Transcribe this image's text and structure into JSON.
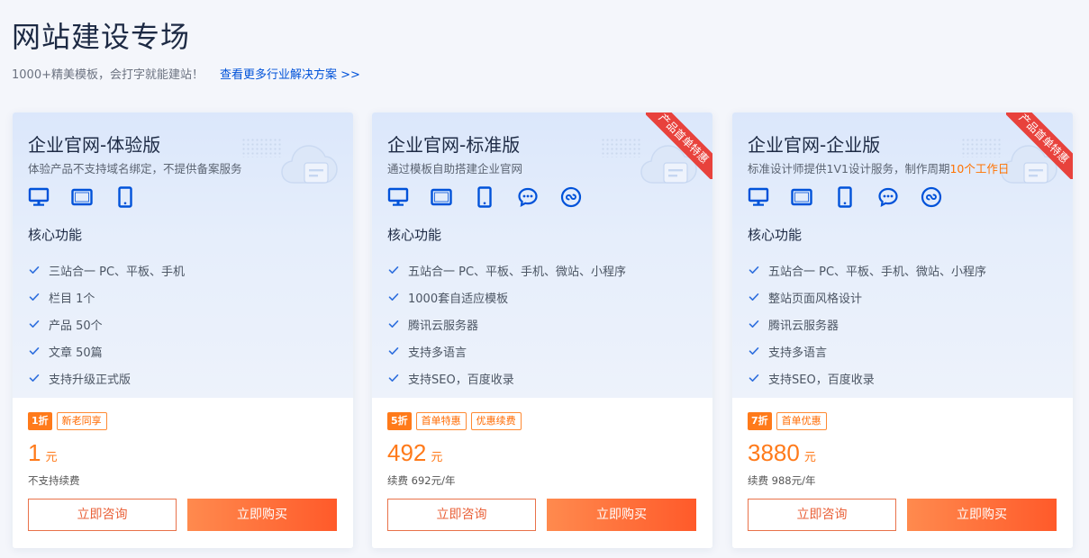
{
  "page": {
    "title": "网站建设专场",
    "subtitle": "1000+精美模板，会打字就能建站！",
    "more_link": "查看更多行业解决方案 >>"
  },
  "colors": {
    "accent": "#0052d9",
    "orange": "#ff7a1a",
    "ribbon": "#e8423c"
  },
  "cards": [
    {
      "title": "企业官网-体验版",
      "desc": "体验产品不支持域名绑定，不提供备案服务",
      "desc_highlight": "",
      "ribbon": "",
      "icons": [
        "desktop-icon",
        "tablet-landscape-icon",
        "mobile-icon"
      ],
      "features_heading": "核心功能",
      "features": [
        "三站合一 PC、平板、手机",
        "栏目 1个",
        "产品 50个",
        "文章 50篇",
        "支持升级正式版"
      ],
      "discount": "1折",
      "tags": [
        "新老同享"
      ],
      "price": "1",
      "price_unit": "元",
      "renew": "不支持续费",
      "consult_label": "立即咨询",
      "buy_label": "立即购买"
    },
    {
      "title": "企业官网-标准版",
      "desc": "通过模板自助搭建企业官网",
      "desc_highlight": "",
      "ribbon": "产品首单特惠",
      "icons": [
        "desktop-icon",
        "tablet-landscape-icon",
        "mobile-icon",
        "wechat-icon",
        "mini-program-icon"
      ],
      "features_heading": "核心功能",
      "features": [
        "五站合一 PC、平板、手机、微站、小程序",
        "1000套自适应模板",
        "腾讯云服务器",
        "支持多语言",
        "支持SEO，百度收录"
      ],
      "discount": "5折",
      "tags": [
        "首单特惠",
        "优惠续费"
      ],
      "price": "492",
      "price_unit": "元",
      "renew": "续费 692元/年",
      "consult_label": "立即咨询",
      "buy_label": "立即购买"
    },
    {
      "title": "企业官网-企业版",
      "desc": "标准设计师提供1V1设计服务，制作周期",
      "desc_highlight": "10个工作日",
      "ribbon": "产品首单特惠",
      "icons": [
        "desktop-icon",
        "tablet-landscape-icon",
        "mobile-icon",
        "wechat-icon",
        "mini-program-icon"
      ],
      "features_heading": "核心功能",
      "features": [
        "五站合一 PC、平板、手机、微站、小程序",
        "整站页面风格设计",
        "腾讯云服务器",
        "支持多语言",
        "支持SEO，百度收录"
      ],
      "discount": "7折",
      "tags": [
        "首单优惠"
      ],
      "price": "3880",
      "price_unit": "元",
      "renew": "续费 988元/年",
      "consult_label": "立即咨询",
      "buy_label": "立即购买"
    }
  ]
}
